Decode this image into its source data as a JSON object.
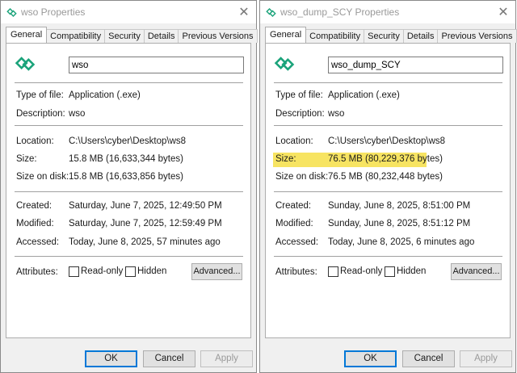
{
  "windows": [
    {
      "title": "wso Properties",
      "tabs": [
        "General",
        "Compatibility",
        "Security",
        "Details",
        "Previous Versions"
      ],
      "name_value": "wso",
      "type_of_file_label": "Type of file:",
      "type_of_file": "Application (.exe)",
      "description_label": "Description:",
      "description": "wso",
      "location_label": "Location:",
      "location": "C:\\Users\\cyber\\Desktop\\ws8",
      "size_label": "Size:",
      "size": "15.8 MB (16,633,344 bytes)",
      "size_on_disk_label": "Size on disk:",
      "size_on_disk": "15.8 MB (16,633,856 bytes)",
      "created_label": "Created:",
      "created": "Saturday, June 7, 2025, 12:49:50 PM",
      "modified_label": "Modified:",
      "modified": "Saturday, June 7, 2025, 12:59:49 PM",
      "accessed_label": "Accessed:",
      "accessed": "Today, June 8, 2025, 57 minutes ago",
      "attributes_label": "Attributes:",
      "readonly_label": "Read-only",
      "hidden_label": "Hidden",
      "advanced_label": "Advanced...",
      "ok_label": "OK",
      "cancel_label": "Cancel",
      "apply_label": "Apply",
      "size_highlighted": false
    },
    {
      "title": "wso_dump_SCY Properties",
      "tabs": [
        "General",
        "Compatibility",
        "Security",
        "Details",
        "Previous Versions"
      ],
      "name_value": "wso_dump_SCY",
      "type_of_file_label": "Type of file:",
      "type_of_file": "Application (.exe)",
      "description_label": "Description:",
      "description": "wso",
      "location_label": "Location:",
      "location": "C:\\Users\\cyber\\Desktop\\ws8",
      "size_label": "Size:",
      "size": "76.5 MB (80,229,376 bytes)",
      "size_on_disk_label": "Size on disk:",
      "size_on_disk": "76.5 MB (80,232,448 bytes)",
      "created_label": "Created:",
      "created": "Sunday, June 8, 2025, 8:51:00 PM",
      "modified_label": "Modified:",
      "modified": "Sunday, June 8, 2025, 8:51:12 PM",
      "accessed_label": "Accessed:",
      "accessed": "Today, June 8, 2025, 6 minutes ago",
      "attributes_label": "Attributes:",
      "readonly_label": "Read-only",
      "hidden_label": "Hidden",
      "advanced_label": "Advanced...",
      "ok_label": "OK",
      "cancel_label": "Cancel",
      "apply_label": "Apply",
      "size_highlighted": true
    }
  ],
  "colors": {
    "icon_teal": "#1aa37a",
    "highlight": "#f7e462",
    "ok_border": "#0078d7"
  },
  "icons": {
    "title": "app-icon",
    "close": "close-icon",
    "file": "app-icon"
  }
}
